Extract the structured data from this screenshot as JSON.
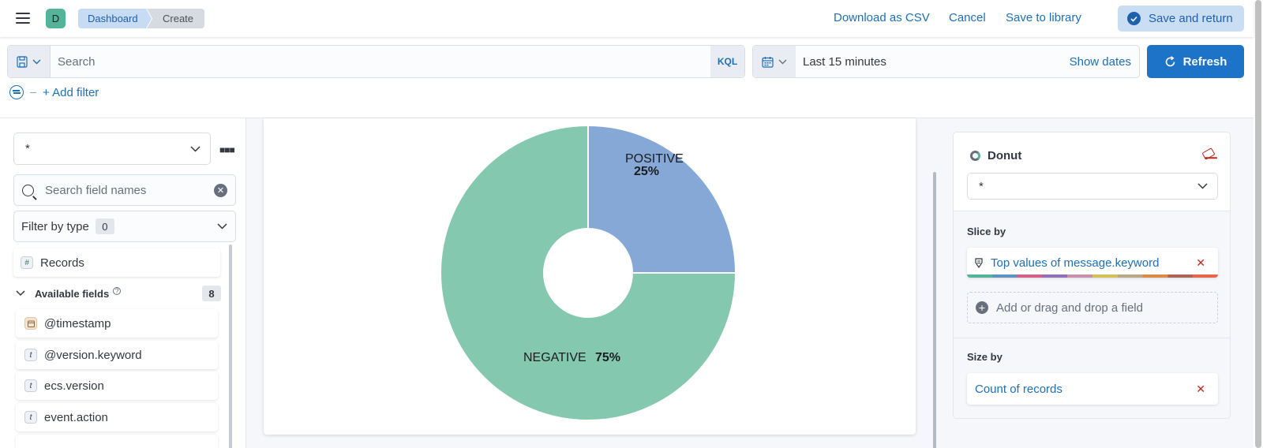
{
  "header": {
    "space_initial": "D",
    "breadcrumbs": [
      "Dashboard",
      "Create"
    ],
    "download_csv": "Download as CSV",
    "cancel": "Cancel",
    "save_to_library": "Save to library",
    "save_and_return": "Save and return"
  },
  "query": {
    "search_placeholder": "Search",
    "language": "KQL",
    "time_range": "Last 15 minutes",
    "show_dates": "Show dates",
    "refresh": "Refresh",
    "add_filter": "+ Add filter"
  },
  "sidebar": {
    "index_pattern": "*",
    "field_search_placeholder": "Search field names",
    "filter_by_type": "Filter by type",
    "filter_count": "0",
    "records_label": "Records",
    "records_type": "#",
    "available_fields_label": "Available fields",
    "available_fields_count": "8",
    "fields": [
      {
        "name": "@timestamp",
        "type": "date"
      },
      {
        "name": "@version.keyword",
        "type": "t"
      },
      {
        "name": "ecs.version",
        "type": "t"
      },
      {
        "name": "event.action",
        "type": "t"
      }
    ]
  },
  "chart_data": {
    "type": "pie",
    "donut": true,
    "slices": [
      {
        "label": "POSITIVE",
        "percent": "25%",
        "value": 25,
        "color": "#85a8d6"
      },
      {
        "label": "NEGATIVE",
        "percent": "75%",
        "value": 75,
        "color": "#85c8b0"
      }
    ]
  },
  "config": {
    "chart_type": "Donut",
    "layer_index": "*",
    "slice_by_label": "Slice by",
    "slice_by_field": "Top values of message.keyword",
    "add_field": "Add or drag and drop a field",
    "size_by_label": "Size by",
    "size_by_field": "Count of records"
  },
  "colors": {
    "accent": "#1d73c7",
    "link": "#1e6fb5",
    "danger": "#bd271e",
    "palette": [
      "#54b399",
      "#6092c0",
      "#d36086",
      "#9170b8",
      "#ca8eae",
      "#d6bf57",
      "#b9a888",
      "#da8b45",
      "#aa6556",
      "#e7664c"
    ]
  }
}
